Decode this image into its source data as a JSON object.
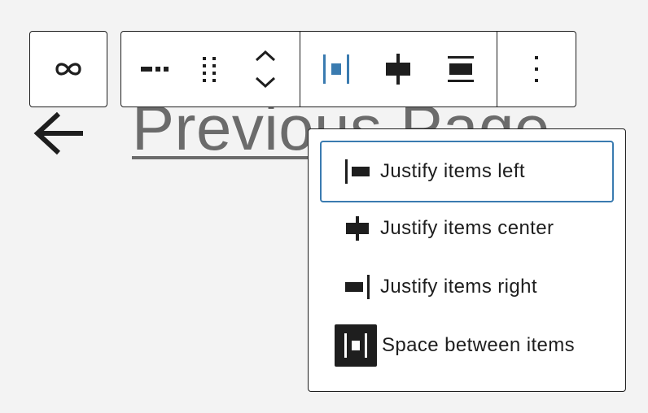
{
  "page": {
    "link_text": "Previous Page",
    "back_icon": "arrow-left-icon"
  },
  "toolbar": {
    "block_icon": "link-icon",
    "buttons": [
      {
        "name": "separator-style-button",
        "icon": "separator-dashes-icon"
      },
      {
        "name": "drag-handle-button",
        "icon": "drag-handle-icon"
      },
      {
        "name": "move-up-down-button",
        "icon": "chevron-up-down-icon"
      },
      {
        "name": "justify-space-between-button",
        "icon": "justify-space-between-icon",
        "active": true
      },
      {
        "name": "justify-center-button",
        "icon": "justify-center-icon"
      },
      {
        "name": "orientation-button",
        "icon": "stretch-horizontal-icon"
      },
      {
        "name": "more-options-button",
        "icon": "more-vertical-icon"
      }
    ],
    "accent_color": "#3a7bb0"
  },
  "menu": {
    "items": [
      {
        "label": "Justify items left",
        "icon": "justify-left-icon",
        "focused": true,
        "selected": false
      },
      {
        "label": "Justify items center",
        "icon": "justify-center-icon",
        "focused": false,
        "selected": false
      },
      {
        "label": "Justify items right",
        "icon": "justify-right-icon",
        "focused": false,
        "selected": false
      },
      {
        "label": "Space between items",
        "icon": "justify-space-between-icon",
        "focused": false,
        "selected": true
      }
    ]
  }
}
